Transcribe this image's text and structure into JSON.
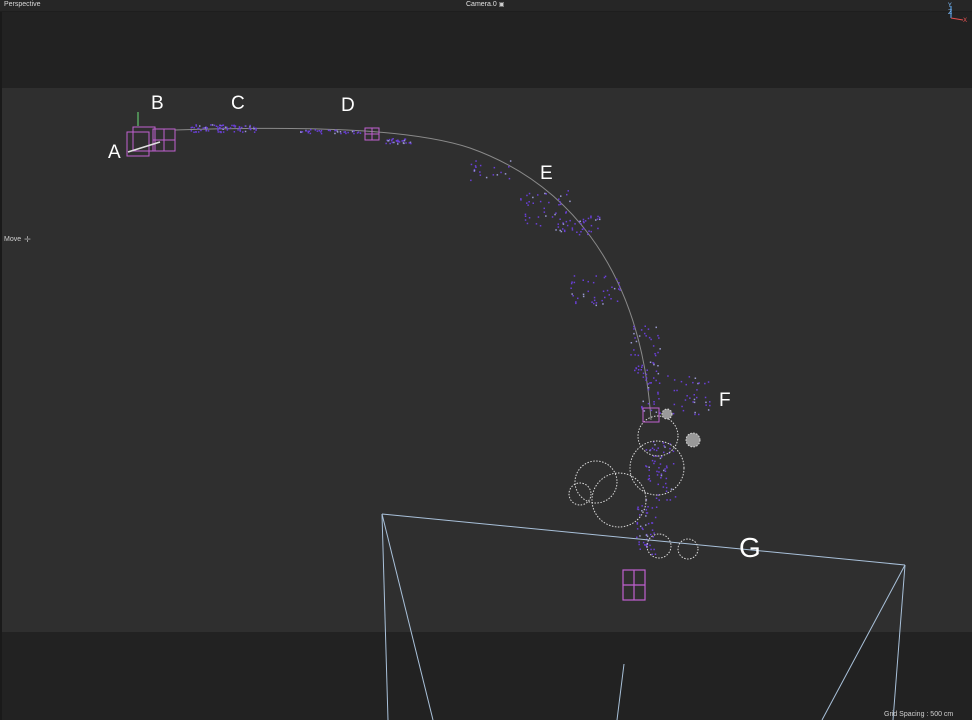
{
  "viewport": {
    "title": "Perspective",
    "camera": "Camera.0",
    "tool": "Move",
    "grid_spacing": "Grid Spacing : 500 cm"
  },
  "axis": {
    "y": "Y",
    "z": "Z",
    "x": "X"
  },
  "labels": {
    "a": "A",
    "b": "B",
    "c": "C",
    "d": "D",
    "e": "E",
    "f": "F",
    "g": "G"
  },
  "colors": {
    "background": "#2f2f2f",
    "letterbox": "#222222",
    "path": "#8a8a8a",
    "particles": "#6a3fd8",
    "selection": "#c060d0",
    "spheres": "#dcdcdc",
    "frustum": "#a9c1da",
    "label": "#ffffff"
  },
  "icons": {
    "camera_menu": "camera-dropdown-icon",
    "move": "move-tool-icon",
    "gizmo": "axis-gizmo-icon"
  }
}
